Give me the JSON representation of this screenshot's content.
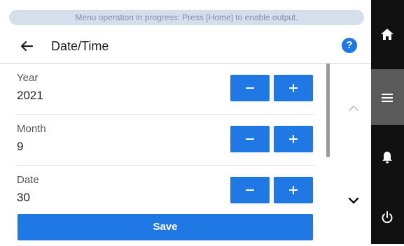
{
  "banner": {
    "text": "Menu operation in progress: Press [Home] to enable output."
  },
  "header": {
    "title": "Date/Time",
    "help_icon_label": "?"
  },
  "fields": [
    {
      "label": "Year",
      "value": "2021"
    },
    {
      "label": "Month",
      "value": "9"
    },
    {
      "label": "Date",
      "value": "30"
    }
  ],
  "save_label": "Save",
  "side_rail": {
    "items": [
      {
        "icon": "home-icon",
        "active": false
      },
      {
        "icon": "menu-icon",
        "active": true
      },
      {
        "icon": "bell-icon",
        "active": false
      },
      {
        "icon": "power-icon",
        "active": false
      }
    ]
  },
  "colors": {
    "accent": "#1f78e3",
    "banner_bg": "#d5deeb",
    "banner_text": "#7f91b1",
    "rail_bg": "#111111",
    "rail_active": "#5a5a5a"
  }
}
